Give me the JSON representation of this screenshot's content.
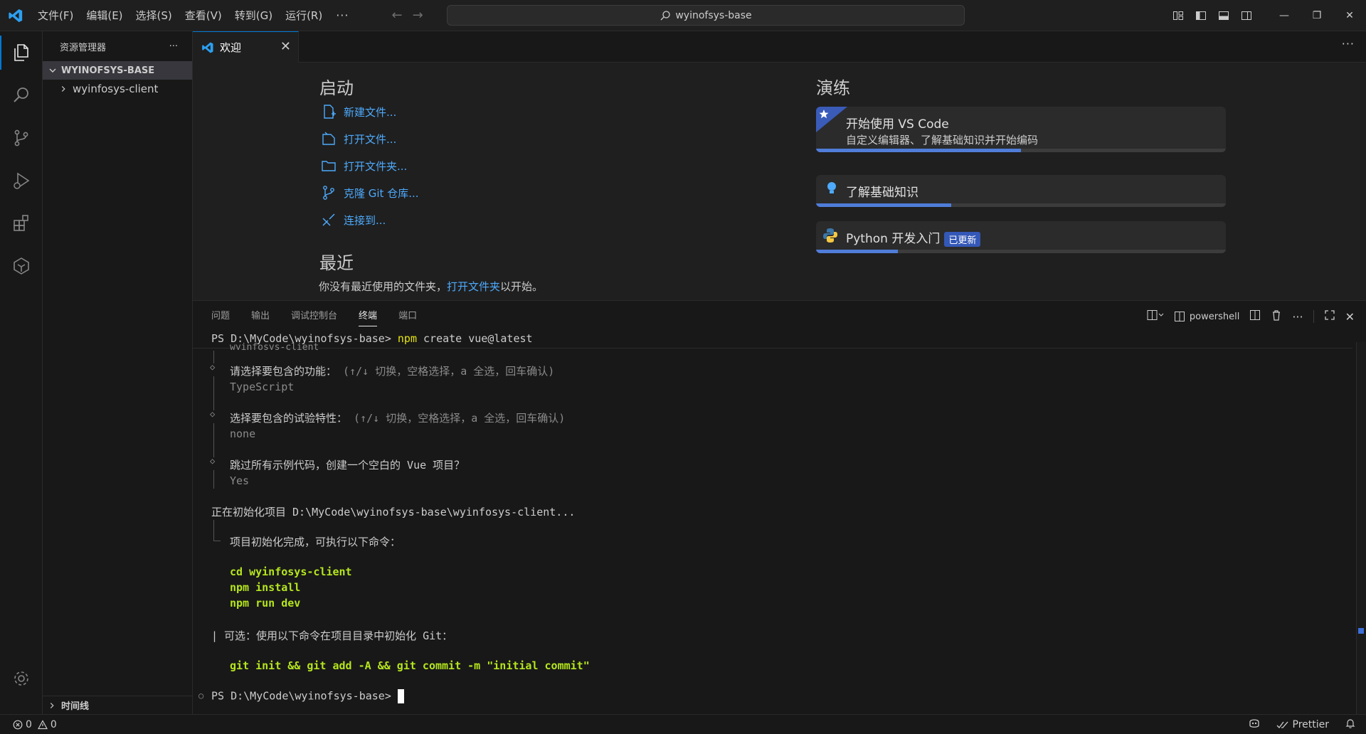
{
  "titlebar": {
    "menu": [
      "文件(F)",
      "编辑(E)",
      "选择(S)",
      "查看(V)",
      "转到(G)",
      "运行(R)"
    ],
    "more": "···",
    "search_text": "wyinofsys-base"
  },
  "activity_bar": {
    "items": [
      "explorer-icon",
      "search-icon",
      "source-control-icon",
      "run-debug-icon",
      "extensions-icon",
      "remote-icon"
    ],
    "bottom": "gear-icon"
  },
  "sidebar": {
    "title": "资源管理器",
    "more": "···",
    "root_folder": "WYINOFSYS-BASE",
    "items": [
      {
        "label": "wyinfosys-client"
      }
    ],
    "timeline": "时间线"
  },
  "editor": {
    "tab_label": "欢迎",
    "more": "···"
  },
  "welcome": {
    "start_title": "启动",
    "start_items": [
      "新建文件...",
      "打开文件...",
      "打开文件夹...",
      "克隆 Git 仓库...",
      "连接到..."
    ],
    "recent_title": "最近",
    "recent_prefix": "你没有最近使用的文件夹，",
    "recent_link": "打开文件夹",
    "recent_suffix": "以开始。",
    "walkthrough_title": "演练",
    "walkthroughs": [
      {
        "title": "开始使用 VS Code",
        "desc": "自定义编辑器、了解基础知识并开始编码",
        "progress": 0.5
      },
      {
        "title": "了解基础知识",
        "progress": 0.33
      },
      {
        "title": "Python 开发入门",
        "badge": "已更新",
        "progress": 0.2
      }
    ],
    "accent_color": "#4daafc"
  },
  "panel": {
    "tabs": [
      "问题",
      "输出",
      "调试控制台",
      "终端",
      "端口"
    ],
    "active_tab": "终端",
    "shell": "powershell",
    "terminal": {
      "prompt1": "PS D:\\MyCode\\wyinofsys-base>",
      "cmd1_npm": "npm",
      "cmd1_rest": " create vue@latest",
      "clipped": "wyinfosys-client",
      "q1": "请选择要包含的功能：",
      "q1_hint": "(↑/↓ 切换，空格选择，a 全选，回车确认)",
      "a1": "TypeScript",
      "q2": "选择要包含的试验特性：",
      "q2_hint": "(↑/↓ 切换，空格选择，a 全选，回车确认)",
      "a2": "none",
      "q3": "跳过所有示例代码，创建一个空白的 Vue 项目？",
      "a3": "Yes",
      "init": "正在初始化项目 D:\\MyCode\\wyinofsys-base\\wyinfosys-client...",
      "done": "项目初始化完成，可执行以下命令：",
      "cmds": [
        "cd wyinfosys-client",
        "npm install",
        "npm run dev"
      ],
      "optional": "| 可选：使用以下命令在项目目录中初始化 Git：",
      "git_cmd": "git init && git add -A && git commit -m \"initial commit\"",
      "prompt2": "PS D:\\MyCode\\wyinofsys-base>"
    }
  },
  "statusbar": {
    "errors": "0",
    "warnings": "0",
    "prettier": "Prettier"
  }
}
